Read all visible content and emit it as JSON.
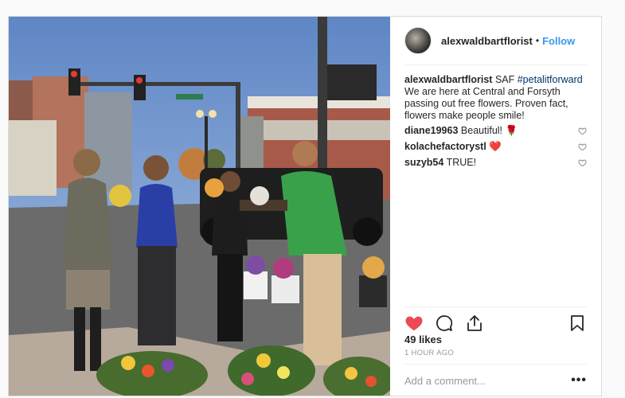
{
  "post": {
    "username": "alexwaldbartflorist",
    "separator": "•",
    "follow_label": "Follow",
    "photo_alt": "People handing out free flowers at a street corner",
    "caption": {
      "username": "alexwaldbartflorist",
      "text_before_tag": "SAF ",
      "hashtag": "#petalitforward",
      "text_after_tag": " We are here at Central and Forsyth passing out free flowers. Proven fact, flowers make people smile!"
    },
    "comments": [
      {
        "username": "diane19963",
        "text": "Beautiful! ",
        "emoji": "🌹"
      },
      {
        "username": "kolachefactorystl",
        "text": " ",
        "emoji": "❤️"
      },
      {
        "username": "suzyb54",
        "text": "TRUE!",
        "emoji": ""
      }
    ],
    "likes": "49 likes",
    "time": "1 HOUR AGO",
    "add_comment_placeholder": "Add a comment...",
    "more_label": "•••",
    "icons": {
      "like": "heart-filled-icon",
      "comment": "comment-bubble-icon",
      "share": "share-icon",
      "save": "bookmark-icon",
      "comment_like": "heart-outline-icon"
    },
    "colors": {
      "like_heart": "#ed4956",
      "follow": "#3897f0",
      "hashtag": "#003569",
      "muted": "#999999"
    }
  }
}
